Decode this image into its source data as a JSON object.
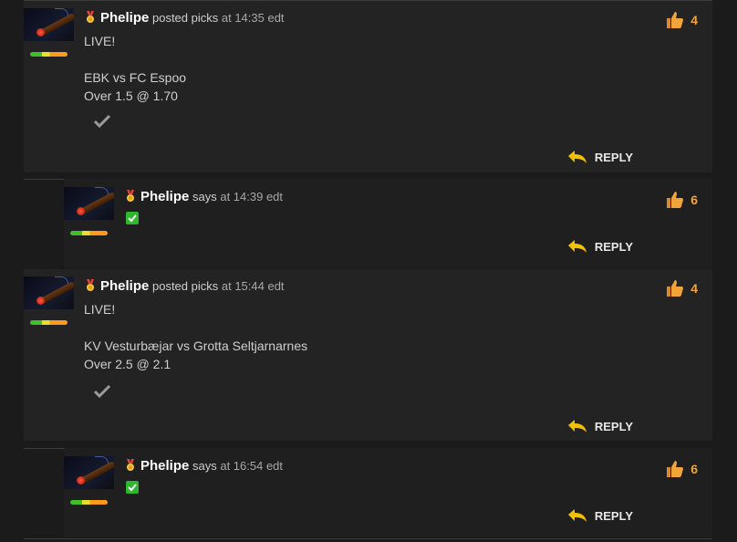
{
  "comments": [
    {
      "author": "Phelipe",
      "action": "posted picks",
      "time": "at 14:35 edt",
      "likes": "4",
      "lines": [
        "LIVE!",
        "",
        "EBK vs FC Espoo",
        "Over 1.5 @ 1.70"
      ],
      "mark": "check-grey",
      "reply_label": "REPLY"
    },
    {
      "author": "Phelipe",
      "action": "says",
      "time": "at 14:39 edt",
      "likes": "6",
      "mark": "check-green",
      "reply_label": "REPLY"
    },
    {
      "author": "Phelipe",
      "action": "posted picks",
      "time": "at 15:44 edt",
      "likes": "4",
      "lines": [
        "LIVE!",
        "",
        "KV Vesturbæjar vs Grotta Seltjarnarnes",
        "Over 2.5 @ 2.1"
      ],
      "mark": "check-grey",
      "reply_label": "REPLY"
    },
    {
      "author": "Phelipe",
      "action": "says",
      "time": "at 16:54 edt",
      "likes": "6",
      "mark": "check-green",
      "reply_label": "REPLY"
    }
  ],
  "colors": {
    "background": "#1b1b1b",
    "panel": "#232323",
    "likes": "#f0a43a",
    "reply_arrow": "#f2c200",
    "check_green": "#2fb82f"
  }
}
